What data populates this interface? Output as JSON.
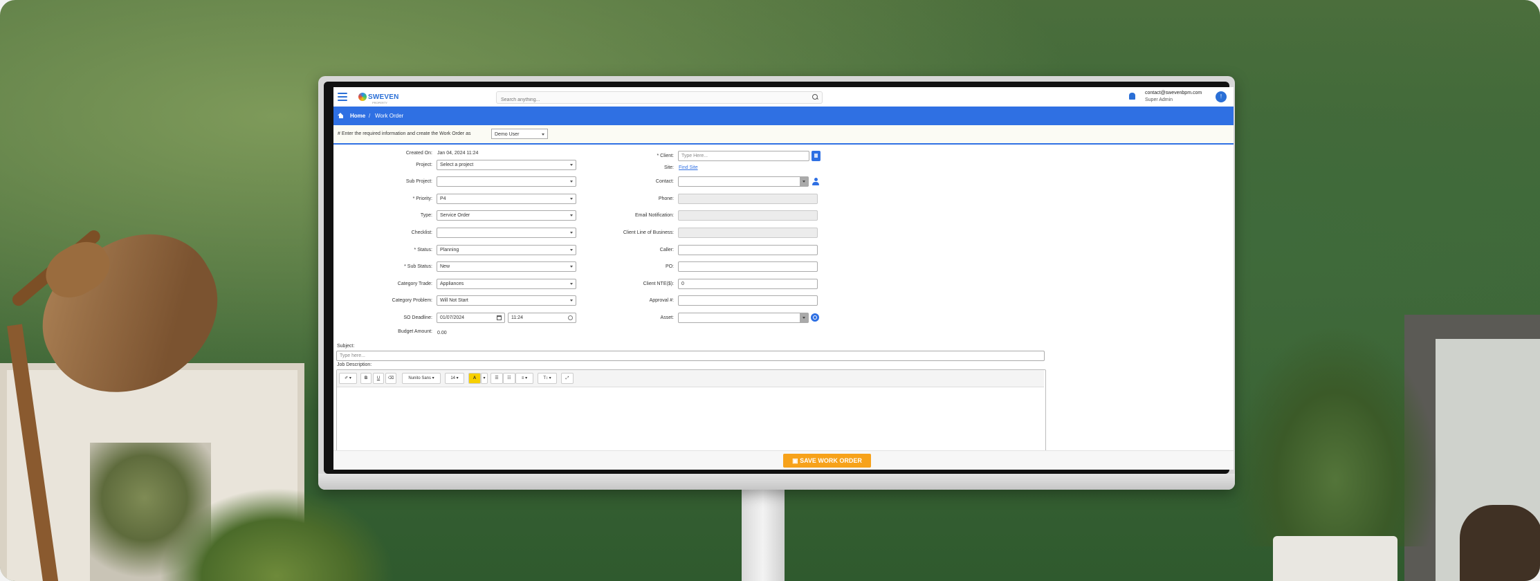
{
  "header": {
    "logo_text": "SWEVEN",
    "logo_sub": "PROPERTY",
    "search_placeholder": "Search anything...",
    "user_email": "contact@swevenbpm.com",
    "user_role": "Super Admin",
    "avatar_initial": "!"
  },
  "breadcrumb": {
    "home": "Home",
    "separator": "/",
    "current": "Work Order"
  },
  "info": {
    "text": "# Enter the required information and create the Work Order as",
    "as_user": "Demo User"
  },
  "form_left": {
    "created_on_label": "Created On:",
    "created_on_value": "Jan 04, 2024 11:24",
    "project_label": "Project:",
    "project_value": "Select a project",
    "sub_project_label": "Sub Project:",
    "sub_project_value": "",
    "priority_label": "* Priority:",
    "priority_value": "P4",
    "type_label": "Type:",
    "type_value": "Service Order",
    "checklist_label": "Checklist:",
    "checklist_value": "",
    "status_label": "* Status:",
    "status_value": "Planning",
    "sub_status_label": "* Sub Status:",
    "sub_status_value": "New",
    "category_trade_label": "Category Trade:",
    "category_trade_value": "Appliances",
    "category_problem_label": "Category Problem:",
    "category_problem_value": "Will Not Start",
    "so_deadline_label": "SO Deadline:",
    "so_deadline_date": "01/07/2024",
    "so_deadline_time": "11:24",
    "budget_label": "Budget Amount:",
    "budget_value": "0.00"
  },
  "form_right": {
    "client_label": "* Client:",
    "client_placeholder": "Type Here...",
    "site_label": "Site:",
    "site_link": "Find Site",
    "contact_label": "Contact:",
    "phone_label": "Phone:",
    "email_label": "Email Notification:",
    "line_of_business_label": "Client Line of Business:",
    "caller_label": "Caller:",
    "po_label": "PO:",
    "nte_label": "Client NTE($):",
    "nte_value": "0",
    "approval_label": "Approval #:",
    "asset_label": "Asset:"
  },
  "subject": {
    "label": "Subject:",
    "placeholder": "Type here..."
  },
  "description": {
    "label": "Job Description:",
    "toolbar": {
      "style": "✐ ▾",
      "bold": "B",
      "underline": "U",
      "eraser": "⌫",
      "font": "Nunito Sans ▾",
      "size": "14 ▾",
      "color": "A",
      "color_caret": "▾",
      "ul": "☰",
      "ol": "☷",
      "align": "≡ ▾",
      "height": "T↕ ▾",
      "fullscreen": "⤢"
    }
  },
  "footer": {
    "save_label": "SAVE WORK ORDER"
  },
  "colors": {
    "primary": "#2f70e3",
    "save": "#f7a21a"
  }
}
